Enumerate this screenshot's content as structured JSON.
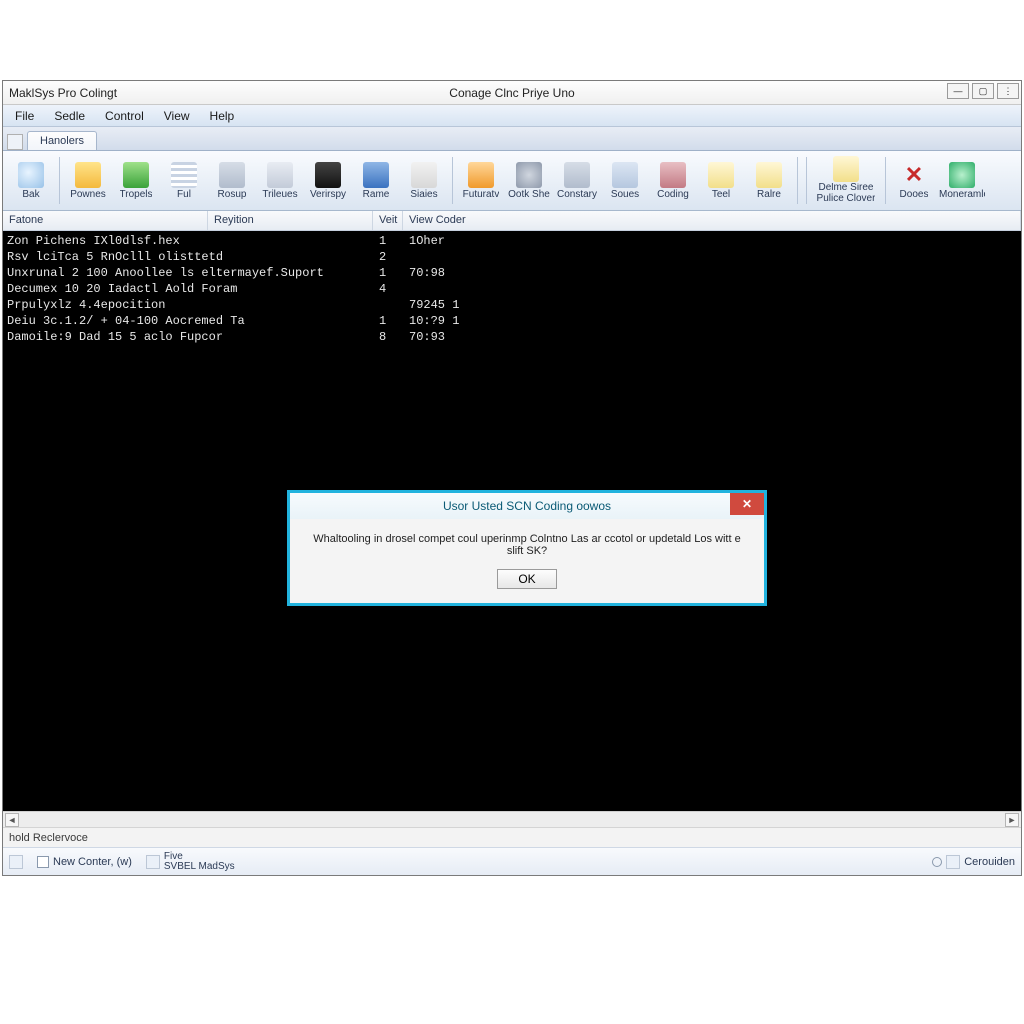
{
  "titlebar": {
    "left": "MaklSys Pro Colingt",
    "center": "Conage Clnc Priye Uno"
  },
  "window_buttons": {
    "min": "—",
    "max": "▢",
    "close": "⋮"
  },
  "menubar": [
    "File",
    "Sedle",
    "Control",
    "View",
    "Help"
  ],
  "tab": "Hanolers",
  "toolbar": [
    {
      "label": "Bak",
      "icon": "ic-globe"
    },
    {
      "label": "Pownes",
      "icon": "ic-yel"
    },
    {
      "label": "Tropels",
      "icon": "ic-grn"
    },
    {
      "label": "Ful",
      "icon": "ic-lines"
    },
    {
      "label": "Rosup",
      "icon": "ic-dev"
    },
    {
      "label": "Trileues",
      "icon": "ic-mon"
    },
    {
      "label": "Verirspy",
      "icon": "ic-blk"
    },
    {
      "label": "Rame",
      "icon": "ic-blu"
    },
    {
      "label": "Siaies",
      "icon": "ic-pen"
    },
    {
      "label": "Futuratv",
      "icon": "ic-org"
    },
    {
      "label": "Ootk She",
      "icon": "ic-gear"
    },
    {
      "label": "Constary",
      "icon": "ic-dev"
    },
    {
      "label": "Soues",
      "icon": "ic-mail"
    },
    {
      "label": "Coding",
      "icon": "ic-shield"
    },
    {
      "label": "Teel",
      "icon": "ic-note"
    },
    {
      "label": "Ralre",
      "icon": "ic-note"
    }
  ],
  "toolbar_right": [
    {
      "line1": "Delme Siree",
      "line2": "Pulice Clover",
      "icon": "ic-note"
    },
    {
      "label": "Dooes",
      "icon_class": "ic-x",
      "glyph": "✕"
    },
    {
      "label": "Moneramlor",
      "icon": "ic-circ"
    }
  ],
  "columns": {
    "c1": "Fatone",
    "c2": "Reyition",
    "c3": "Veit",
    "c4": "View Coder"
  },
  "rows": [
    {
      "a": "Zon Pichens  IXl0dlsf.hex",
      "b": "1",
      "c": "1Oher"
    },
    {
      "a": "Rsv  lciTca 5   RnOclll olisttetd",
      "b": "2",
      "c": ""
    },
    {
      "a": "Unxrunal 2 100 Anoollee ls eltermayef.Suport",
      "b": "1",
      "c": "70:98"
    },
    {
      "a": "Decumex 10 20 Iadactl Aold  Foram",
      "b": "4",
      "c": ""
    },
    {
      "a": "Prpulyxlz  4.4epocition",
      "b": "",
      "c": "79245 1"
    },
    {
      "a": "Deiu 3c.1.2/ + 04-100 Aocremed Ta",
      "b": "1",
      "c": "10:?9 1"
    },
    {
      "a": "Damoile:9 Dad 15 5 aclo Fupcor",
      "b": "8",
      "c": "70:93"
    }
  ],
  "dialog": {
    "title": "Usor Usted SCN Coding oowos",
    "body": "Whaltooling in drosel compet coul uperinmp Colntno Las ar ccotol or updetald Los witt e slift SK?",
    "ok": "OK"
  },
  "statusbar1": "hold Reclervoce",
  "taskbar": {
    "item1": "New Conter, (w)",
    "item2a": "Five",
    "item2b": "SVBEL MadSys",
    "right": "Cerouiden"
  }
}
